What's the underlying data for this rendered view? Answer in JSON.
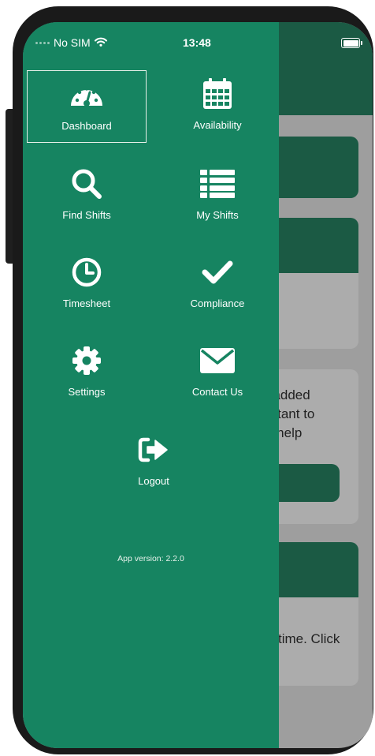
{
  "status_bar": {
    "carrier": "No SIM",
    "time": "13:48"
  },
  "menu": {
    "dashboard": "Dashboard",
    "availability": "Availability",
    "find_shifts": "Find Shifts",
    "my_shifts": "My Shifts",
    "timesheet": "Timesheet",
    "compliance": "Compliance",
    "settings": "Settings",
    "contact_us": "Contact Us",
    "logout": "Logout"
  },
  "app_version": "App version: 2.2.0",
  "background": {
    "card3_lines": [
      "t added",
      "ortant to",
      "n help"
    ],
    "card4_line": "time. Click"
  },
  "colors": {
    "drawer": "#168461",
    "header": "#1b5a44",
    "overlay": "#9e9e9e"
  },
  "icons": {
    "dashboard": "speedometer-icon",
    "availability": "calendar-icon",
    "find_shifts": "search-icon",
    "my_shifts": "list-icon",
    "timesheet": "clock-icon",
    "compliance": "check-icon",
    "settings": "gear-icon",
    "contact_us": "envelope-icon",
    "logout": "logout-icon"
  }
}
